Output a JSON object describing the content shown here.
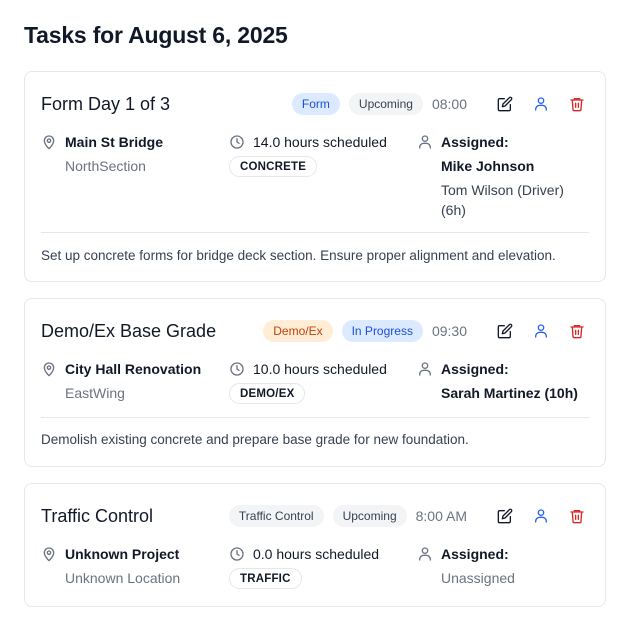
{
  "page": {
    "title": "Tasks for August 6, 2025"
  },
  "colors": {
    "accent_blue": "#2563eb",
    "delete_red": "#dc2626"
  },
  "icons": {
    "edit": "edit-icon",
    "assign": "user-icon",
    "delete": "trash-icon",
    "location": "map-pin-icon",
    "clock": "clock-icon",
    "assigned": "user-icon"
  },
  "tasks": [
    {
      "title": "Form Day 1 of 3",
      "type_badge": "Form",
      "status_badge": "Upcoming",
      "time": "08:00",
      "project": "Main St Bridge",
      "location": "NorthSection",
      "hours": "14.0 hours scheduled",
      "tag": "CONCRETE",
      "assigned_label": "Assigned:",
      "assignees": [
        "Mike Johnson",
        "Tom Wilson (Driver) (6h)"
      ],
      "description": "Set up concrete forms for bridge deck section. Ensure proper alignment and elevation."
    },
    {
      "title": "Demo/Ex Base Grade",
      "type_badge": "Demo/Ex",
      "status_badge": "In Progress",
      "time": "09:30",
      "project": "City Hall Renovation",
      "location": "EastWing",
      "hours": "10.0 hours scheduled",
      "tag": "DEMO/EX",
      "assigned_label": "Assigned:",
      "assignees": [
        "Sarah Martinez (10h)"
      ],
      "description": "Demolish existing concrete and prepare base grade for new foundation."
    },
    {
      "title": "Traffic Control",
      "type_badge": "Traffic Control",
      "status_badge": "Upcoming",
      "time": "8:00 AM",
      "project": "Unknown Project",
      "location": "Unknown Location",
      "hours": "0.0 hours scheduled",
      "tag": "TRAFFIC",
      "assigned_label": "Assigned:",
      "assignees": [
        "Unassigned"
      ]
    }
  ]
}
